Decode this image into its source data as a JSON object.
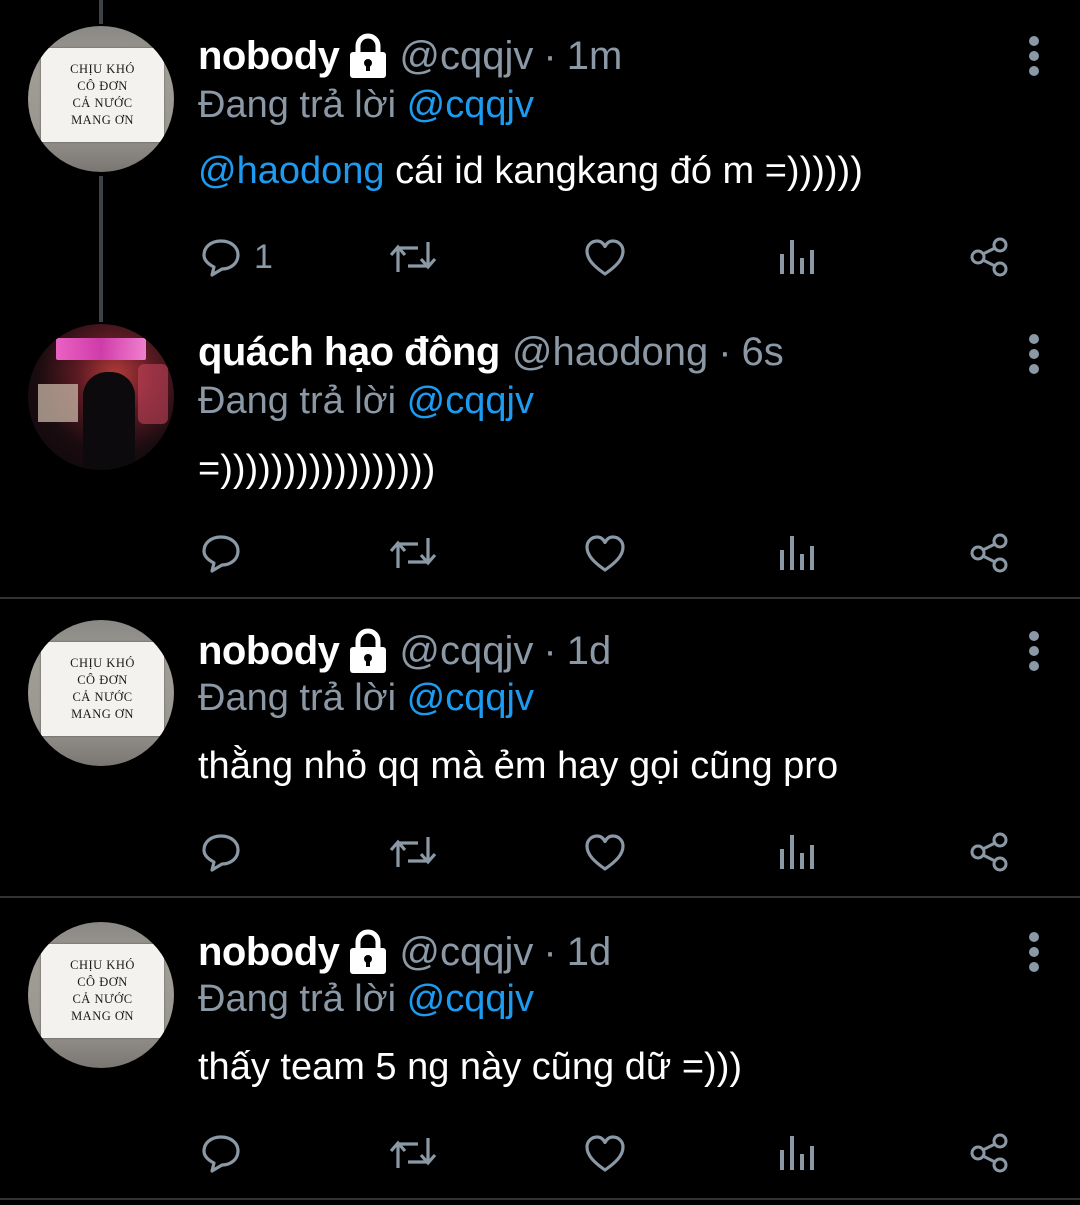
{
  "tweets": [
    {
      "avatar": {
        "type": "note",
        "lines": [
          "CHỊU KHÓ",
          "CÔ ĐƠN",
          "CẢ NƯỚC",
          "MANG ƠN"
        ]
      },
      "name": "nobody",
      "protected": true,
      "handle": "@cqqjv",
      "separator": "·",
      "time": "1m",
      "replying_label": "Đang trả lời",
      "replying_to": "@cqqjv",
      "text_mention": "@haodong",
      "text": " cái id kangkang đó m =))))))",
      "reply_count": "1"
    },
    {
      "avatar": {
        "type": "photo"
      },
      "name": "quách hạo đông",
      "protected": false,
      "handle": "@haodong",
      "separator": "·",
      "time": "6s",
      "replying_label": "Đang trả lời",
      "replying_to": "@cqqjv",
      "text": "=)))))))))))))))))",
      "reply_count": ""
    },
    {
      "avatar": {
        "type": "note",
        "lines": [
          "CHỊU KHÓ",
          "CÔ ĐƠN",
          "CẢ NƯỚC",
          "MANG ƠN"
        ]
      },
      "name": "nobody",
      "protected": true,
      "handle": "@cqqjv",
      "separator": "·",
      "time": "1d",
      "replying_label": "Đang trả lời",
      "replying_to": "@cqqjv",
      "text": "thằng nhỏ qq mà ẻm hay gọi cũng pro",
      "reply_count": ""
    },
    {
      "avatar": {
        "type": "note",
        "lines": [
          "CHỊU KHÓ",
          "CÔ ĐƠN",
          "CẢ NƯỚC",
          "MANG ƠN"
        ]
      },
      "name": "nobody",
      "protected": true,
      "handle": "@cqqjv",
      "separator": "·",
      "time": "1d",
      "replying_label": "Đang trả lời",
      "replying_to": "@cqqjv",
      "text": "thấy team 5 ng này cũng dữ =)))",
      "reply_count": ""
    }
  ],
  "colors": {
    "background": "#000000",
    "name": "#ffffff",
    "secondary": "#8b98a5",
    "mention": "#1d9bf0",
    "divider": "#2f3336"
  },
  "icons": [
    "lock-icon",
    "more-icon",
    "reply-icon",
    "retweet-icon",
    "like-icon",
    "analytics-icon",
    "share-icon"
  ]
}
